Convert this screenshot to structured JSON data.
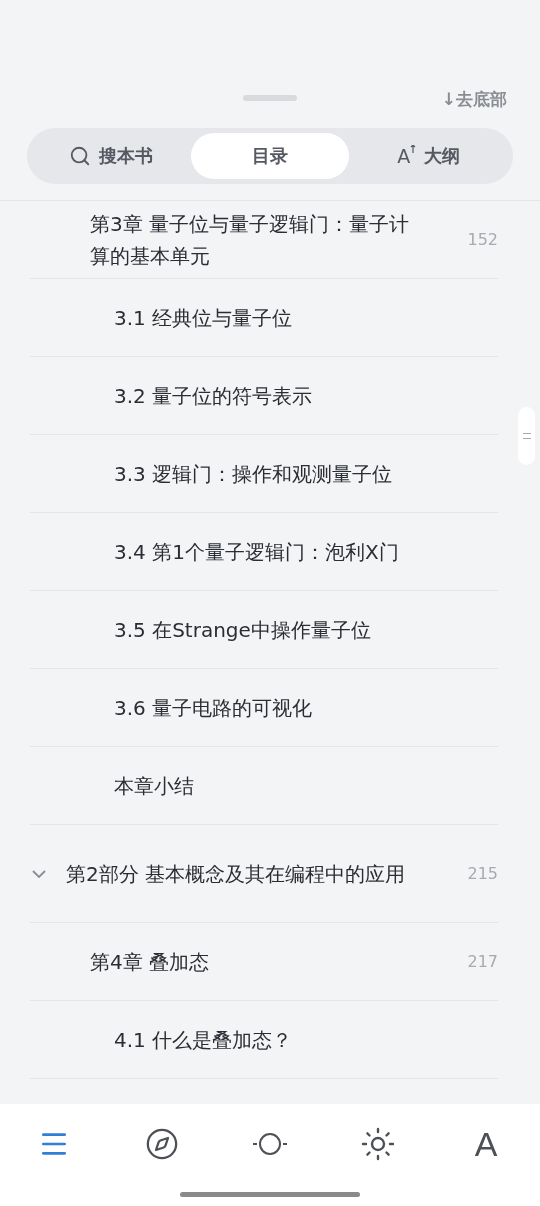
{
  "go_bottom": "↓去底部",
  "tabs": [
    {
      "kind": "search",
      "label": "搜本书",
      "selected": false
    },
    {
      "kind": "plain",
      "label": "目录",
      "selected": true
    },
    {
      "kind": "ai",
      "icon_text": "A",
      "label": "大纲",
      "selected": false
    }
  ],
  "toc": [
    {
      "kind": "chapter",
      "title": "第3章 量子位与量子逻辑门：量子计算的基本单元",
      "page": "152",
      "children": [
        {
          "kind": "section",
          "title": "3.1 经典位与量子位"
        },
        {
          "kind": "section",
          "title": "3.2 量子位的符号表示"
        },
        {
          "kind": "section",
          "title": "3.3 逻辑门：操作和观测量子位"
        },
        {
          "kind": "section",
          "title": "3.4 第1个量子逻辑门：泡利X门"
        },
        {
          "kind": "section",
          "title": "3.5 在Strange中操作量子位"
        },
        {
          "kind": "section",
          "title": "3.6 量子电路的可视化"
        },
        {
          "kind": "section",
          "title": "本章小结"
        }
      ]
    },
    {
      "kind": "part",
      "title": "第2部分 基本概念及其在编程中的应用",
      "page": "215",
      "expanded": true,
      "children": [
        {
          "kind": "chapter",
          "title": "第4章 叠加态",
          "page": "217",
          "children": [
            {
              "kind": "section",
              "title": "4.1 什么是叠加态？"
            }
          ]
        }
      ]
    }
  ],
  "bottom_bar": [
    {
      "kind": "menu",
      "selected": true
    },
    {
      "kind": "compass",
      "selected": false
    },
    {
      "kind": "dim",
      "selected": false
    },
    {
      "kind": "bright",
      "selected": false
    },
    {
      "kind": "font",
      "text": "A",
      "selected": false
    }
  ]
}
